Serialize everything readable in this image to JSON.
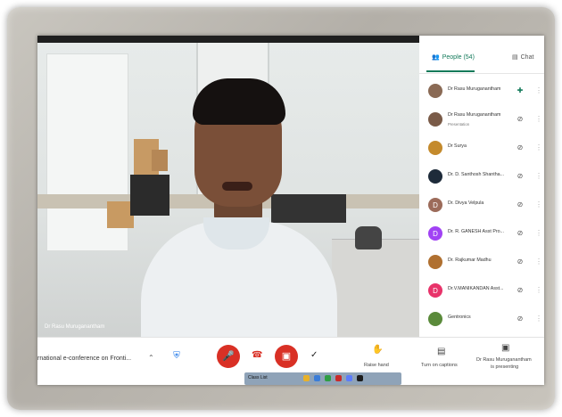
{
  "video": {
    "speaker_label": "Dr Rasu Muruganantham"
  },
  "sidebar": {
    "tabs": {
      "people": "People (54)",
      "chat": "Chat"
    },
    "participants": [
      {
        "name": "Dr Rasu Muruganantham",
        "sub": "",
        "avatar": "photo",
        "color": "#8a6a55",
        "status_icon": "pin-icon"
      },
      {
        "name": "Dr Rasu Muruganantham",
        "sub": "Presentation",
        "avatar": "photo",
        "color": "#7a5b48",
        "status_icon": "mic-off-icon"
      },
      {
        "name": "Dr Surya",
        "sub": "",
        "avatar": "photo",
        "color": "#c48a2c",
        "status_icon": "mic-off-icon"
      },
      {
        "name": "Dr. D. Santhosh Shantha...",
        "sub": "",
        "avatar": "photo",
        "color": "#1e2b3a",
        "status_icon": "mic-off-icon"
      },
      {
        "name": "Dr. Divya Velpula",
        "sub": "",
        "avatar": "D",
        "color": "#9c6b5a",
        "status_icon": "mic-off-icon"
      },
      {
        "name": "Dr. R. GANESH Asst Pro...",
        "sub": "",
        "avatar": "D",
        "color": "#a142f4",
        "status_icon": "mic-off-icon"
      },
      {
        "name": "Dr. Rajkumar Madhu",
        "sub": "",
        "avatar": "photo",
        "color": "#b07030",
        "status_icon": "mic-off-icon"
      },
      {
        "name": "Dr.V.MANIKANDAN Asst...",
        "sub": "",
        "avatar": "D",
        "color": "#e8336a",
        "status_icon": "mic-off-icon"
      },
      {
        "name": "Gentronics",
        "sub": "",
        "avatar": "photo",
        "color": "#5a8a3a",
        "status_icon": "mic-off-icon"
      }
    ]
  },
  "controls": {
    "meeting_title": "rnational e-conference on Fronti...",
    "raise_hand": "Raise hand",
    "captions": "Turn on captions",
    "presenting_line1": "Dr Rasu Muruganantham",
    "presenting_line2": "is presenting"
  },
  "taskbar": {
    "item": "Class List"
  }
}
